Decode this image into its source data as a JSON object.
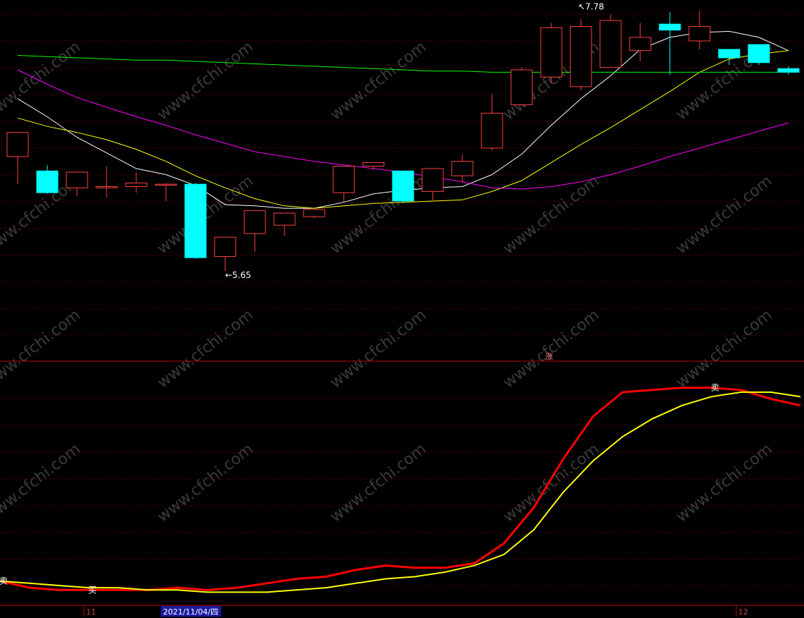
{
  "chart_data": [
    {
      "type": "candlestick",
      "ylim": [
        5.0,
        8.0
      ],
      "grid": true,
      "candles": [
        {
          "o": 6.7,
          "h": 6.87,
          "l": 6.47,
          "c": 6.9
        },
        {
          "o": 6.58,
          "h": 6.63,
          "l": 6.39,
          "c": 6.4
        },
        {
          "o": 6.44,
          "h": 6.5,
          "l": 6.37,
          "c": 6.57
        },
        {
          "o": 6.44,
          "h": 6.62,
          "l": 6.36,
          "c": 6.45
        },
        {
          "o": 6.45,
          "h": 6.57,
          "l": 6.4,
          "c": 6.48
        },
        {
          "o": 6.47,
          "h": 6.48,
          "l": 6.33,
          "c": 6.47
        },
        {
          "o": 6.47,
          "h": 6.48,
          "l": 5.85,
          "c": 5.86
        },
        {
          "o": 5.87,
          "h": 5.91,
          "l": 5.75,
          "c": 6.03
        },
        {
          "o": 6.06,
          "h": 6.1,
          "l": 5.91,
          "c": 6.25
        },
        {
          "o": 6.13,
          "h": 6.2,
          "l": 6.04,
          "c": 6.23
        },
        {
          "o": 6.2,
          "h": 6.27,
          "l": 6.19,
          "c": 6.26
        },
        {
          "o": 6.4,
          "h": 6.62,
          "l": 6.32,
          "c": 6.62
        },
        {
          "o": 6.62,
          "h": 6.6,
          "l": 6.59,
          "c": 6.65
        },
        {
          "o": 6.58,
          "h": 6.56,
          "l": 6.31,
          "c": 6.33
        },
        {
          "o": 6.41,
          "h": 6.59,
          "l": 6.33,
          "c": 6.6
        },
        {
          "o": 6.54,
          "h": 6.72,
          "l": 6.49,
          "c": 6.66
        },
        {
          "o": 6.77,
          "h": 7.22,
          "l": 6.75,
          "c": 7.06
        },
        {
          "o": 7.13,
          "h": 7.44,
          "l": 7.13,
          "c": 7.42
        },
        {
          "o": 7.36,
          "h": 7.81,
          "l": 7.31,
          "c": 7.77
        },
        {
          "o": 7.28,
          "h": 7.84,
          "l": 7.25,
          "c": 7.78
        },
        {
          "o": 7.44,
          "h": 7.88,
          "l": 7.55,
          "c": 7.83
        },
        {
          "o": 7.58,
          "h": 7.81,
          "l": 7.49,
          "c": 7.69
        },
        {
          "o": 7.8,
          "h": 7.9,
          "l": 7.38,
          "c": 7.75
        },
        {
          "o": 7.66,
          "h": 7.91,
          "l": 7.59,
          "c": 7.78
        },
        {
          "o": 7.59,
          "h": 7.54,
          "l": 7.46,
          "c": 7.52
        },
        {
          "o": 7.63,
          "h": 7.61,
          "l": 7.46,
          "c": 7.48
        },
        {
          "o": 7.43,
          "h": 7.45,
          "l": 7.38,
          "c": 7.4
        }
      ],
      "moving_averages": [
        {
          "color": "#ffffff",
          "values": [
            7.18,
            7.03,
            6.86,
            6.73,
            6.6,
            6.55,
            6.46,
            6.3,
            6.29,
            6.27,
            6.27,
            6.32,
            6.39,
            6.42,
            6.44,
            6.45,
            6.55,
            6.72,
            6.96,
            7.18,
            7.37,
            7.59,
            7.69,
            7.73,
            7.74,
            7.69,
            7.58
          ]
        },
        {
          "color": "#ffff00",
          "values": [
            7.02,
            6.95,
            6.9,
            6.84,
            6.76,
            6.66,
            6.54,
            6.44,
            6.35,
            6.29,
            6.27,
            6.29,
            6.31,
            6.32,
            6.33,
            6.34,
            6.41,
            6.5,
            6.65,
            6.8,
            6.94,
            7.09,
            7.24,
            7.4,
            7.51,
            7.55,
            7.58
          ]
        },
        {
          "color": "#ff00ff",
          "values": [
            7.42,
            7.3,
            7.19,
            7.11,
            7.03,
            6.96,
            6.88,
            6.81,
            6.74,
            6.7,
            6.66,
            6.63,
            6.6,
            6.57,
            6.53,
            6.49,
            6.44,
            6.43,
            6.45,
            6.49,
            6.55,
            6.62,
            6.7,
            6.77,
            6.84,
            6.91,
            6.98
          ]
        },
        {
          "color": "#00ff00",
          "values": [
            7.54,
            7.53,
            7.52,
            7.51,
            7.5,
            7.5,
            7.49,
            7.48,
            7.47,
            7.46,
            7.45,
            7.44,
            7.43,
            7.42,
            7.41,
            7.41,
            7.4,
            7.4,
            7.4,
            7.4,
            7.4,
            7.4,
            7.4,
            7.4,
            7.4,
            7.4,
            7.4
          ]
        }
      ],
      "annotations": [
        {
          "text": "←5.65",
          "index": 7
        },
        {
          "text": "↖7.78",
          "index": 19
        }
      ]
    },
    {
      "type": "line",
      "ylim": [
        0,
        100
      ],
      "grid": true,
      "series": [
        {
          "color": "#ff0000",
          "values": [
            9,
            6,
            5,
            5,
            5,
            5,
            6,
            5,
            6,
            8,
            10,
            11,
            14,
            16,
            15,
            15,
            17,
            26,
            42,
            64,
            83,
            94,
            95,
            96,
            96,
            95,
            91,
            88
          ]
        },
        {
          "color": "#ffff00",
          "values": [
            9,
            8,
            7,
            6,
            6,
            5,
            5,
            4,
            4,
            4,
            5,
            6,
            8,
            10,
            11,
            13,
            16,
            21,
            32,
            49,
            63,
            74,
            82,
            88,
            92,
            94,
            94,
            92
          ]
        }
      ],
      "signals": [
        {
          "text": "卖",
          "index": 0
        },
        {
          "text": "买",
          "index": 3
        },
        {
          "text": "卖",
          "index": 24
        }
      ]
    }
  ],
  "upper_tag": "涨",
  "x_axis": {
    "labels": [
      {
        "text": "11",
        "index": 2
      },
      {
        "text": "2021/11/04/四",
        "index": 5
      },
      {
        "text": "12",
        "index": 24
      }
    ]
  },
  "watermark": "www.cfchi.com",
  "colors": {
    "up": "#ff4040",
    "down": "#00ffff",
    "grid": "#5a0000",
    "divider": "#c00000"
  }
}
